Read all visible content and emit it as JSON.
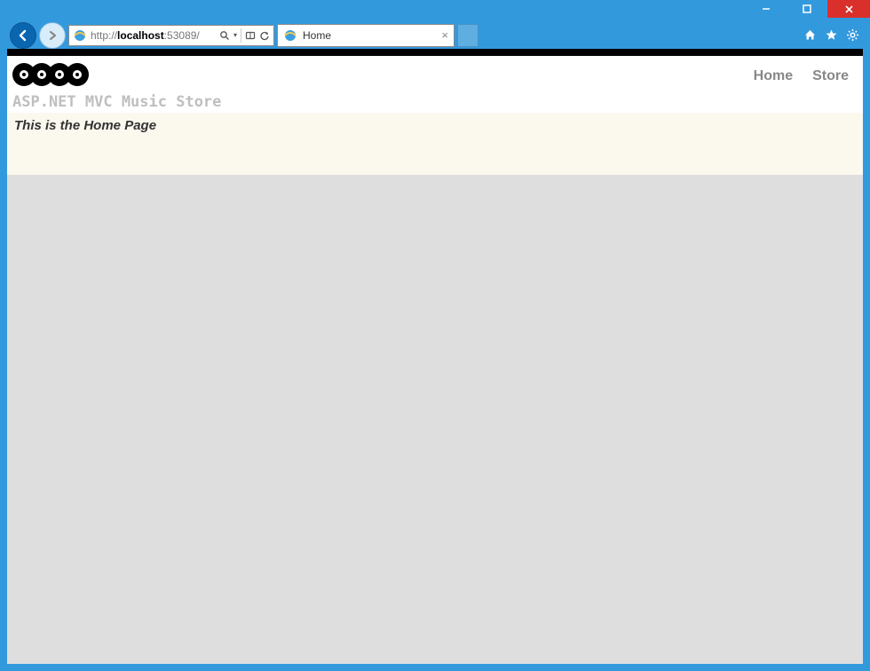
{
  "window": {
    "url_prefix": "http://",
    "url_host": "localhost",
    "url_suffix": ":53089/",
    "tab_title": "Home"
  },
  "nav": {
    "links": [
      "Home",
      "Store"
    ]
  },
  "site": {
    "title": "ASP.NET MVC Music Store"
  },
  "page": {
    "heading": "This is the Home Page"
  }
}
